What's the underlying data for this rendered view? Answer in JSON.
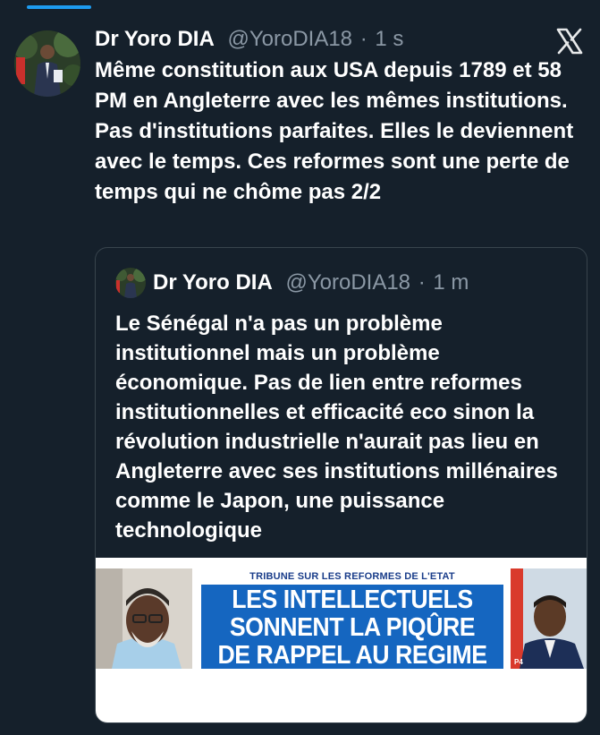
{
  "tweet": {
    "name": "Dr Yoro DIA",
    "handle": "@YoroDIA18",
    "separator": "·",
    "time": "1 s",
    "text": "Même constitution aux USA depuis 1789 et 58 PM en Angleterre avec les mêmes institutions. Pas d'institutions parfaites. Elles le deviennent avec le temps. Ces reformes sont une perte de temps qui ne chôme pas 2/2"
  },
  "quote": {
    "name": "Dr Yoro DIA",
    "handle": "@YoroDIA18",
    "separator": "·",
    "time": "1 m",
    "text": "Le Sénégal n'a pas un problème institutionnel mais un problème économique. Pas de lien entre reformes institutionnelles et efficacité eco sinon la révolution industrielle n'aurait pas lieu en Angleterre avec ses institutions millénaires comme le Japon, une puissance technologique",
    "image": {
      "kicker": "TRIBUNE SUR LES REFORMES DE L'ETAT",
      "headline_line1": "LES INTELLECTUELS",
      "headline_line2": "SONNENT LA PIQÛRE",
      "headline_line3": "DE RAPPEL AU REGIME",
      "page_tag": "P4"
    }
  },
  "icons": {
    "x_logo": "x-logo-icon"
  },
  "colors": {
    "background": "#15202b",
    "accent": "#1d9bf0",
    "muted": "#8b98a5",
    "newspaper_blue": "#1566c0"
  }
}
